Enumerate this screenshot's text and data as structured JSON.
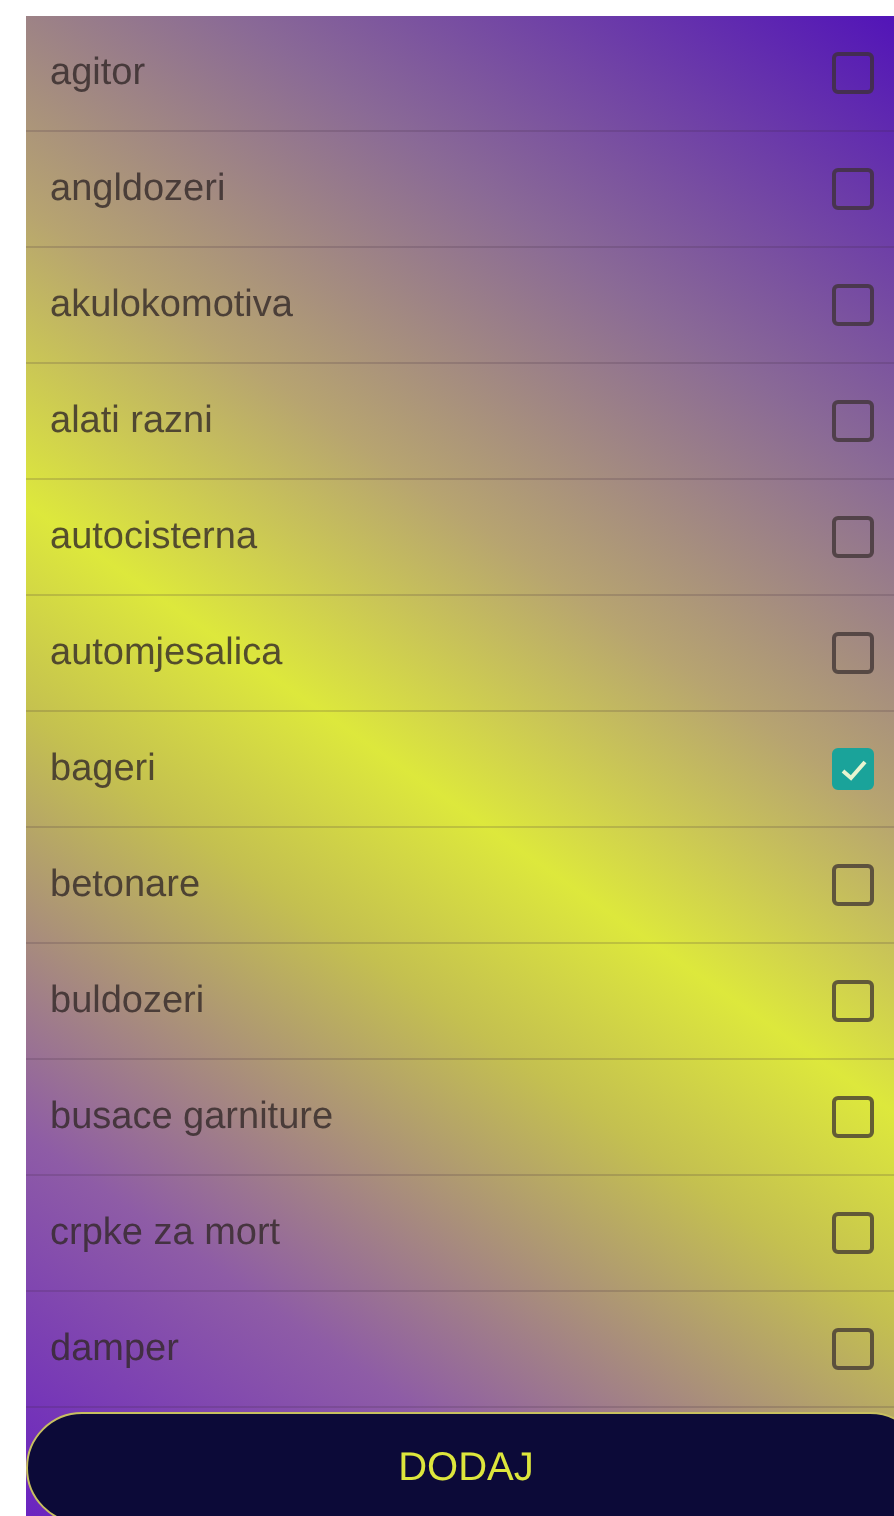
{
  "items": [
    {
      "label": "agitor",
      "checked": false
    },
    {
      "label": "angldozeri",
      "checked": false
    },
    {
      "label": "akulokomotiva",
      "checked": false
    },
    {
      "label": "alati razni",
      "checked": false
    },
    {
      "label": "autocisterna",
      "checked": false
    },
    {
      "label": "automjesalica",
      "checked": false
    },
    {
      "label": "bageri",
      "checked": true
    },
    {
      "label": "betonare",
      "checked": false
    },
    {
      "label": "buldozeri",
      "checked": false
    },
    {
      "label": "busace garniture",
      "checked": false
    },
    {
      "label": "crpke za mort",
      "checked": false
    },
    {
      "label": "damper",
      "checked": false
    }
  ],
  "button": {
    "label": "DODAJ"
  }
}
